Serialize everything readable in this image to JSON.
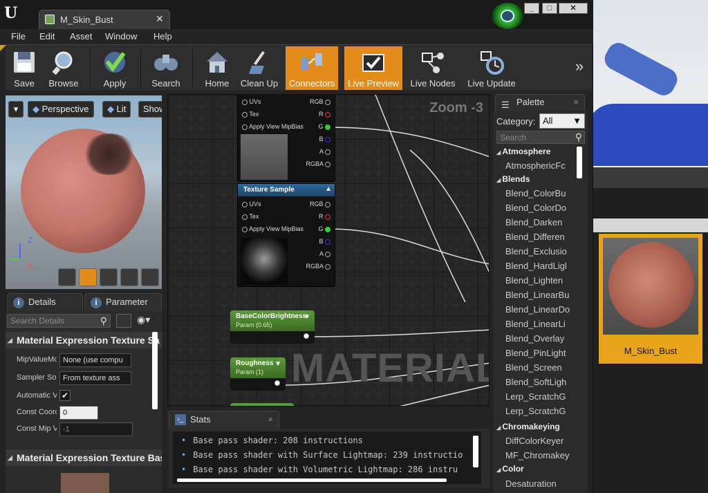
{
  "window": {
    "tab_title": "M_Skin_Bust"
  },
  "menu": [
    "File",
    "Edit",
    "Asset",
    "Window",
    "Help"
  ],
  "toolbar": {
    "save": "Save",
    "browse": "Browse",
    "apply": "Apply",
    "search": "Search",
    "home": "Home",
    "cleanup": "Clean Up",
    "connectors": "Connectors",
    "livepreview": "Live Preview",
    "livenodes": "Live Nodes",
    "liveupdate": "Live Update"
  },
  "viewport": {
    "perspective": "Perspective",
    "lit": "Lit",
    "show": "Show",
    "axis_z": "Z",
    "axis_x": "X"
  },
  "details": {
    "tab_details": "Details",
    "tab_params": "Parameter",
    "search_placeholder": "Search Details",
    "section1": "Material Expression Texture Sa",
    "section2": "Material Expression Texture Bas",
    "rows": [
      {
        "label": "MipValueMo",
        "value": "None (use compu"
      },
      {
        "label": "Sampler So",
        "value": "From texture ass"
      },
      {
        "label": "Automatic V",
        "value": "✔"
      },
      {
        "label": "Const Coord",
        "value": "0"
      },
      {
        "label": "Const Mip V",
        "value": "-1"
      }
    ]
  },
  "graph": {
    "zoom": "Zoom -3",
    "watermark": "MATERIAL",
    "node1": {
      "pins": [
        "UVs",
        "Tex",
        "Apply View MipBias"
      ],
      "outs": [
        "RGB",
        "R",
        "G",
        "B",
        "A",
        "RGBA"
      ]
    },
    "node2": {
      "title": "Texture Sample",
      "pins": [
        "UVs",
        "Tex",
        "Apply View MipBias"
      ],
      "outs": [
        "RGB",
        "R",
        "G",
        "B",
        "A",
        "RGBA"
      ]
    },
    "param1": {
      "title": "BaseColorBrightness",
      "sub": "Param (0.65)"
    },
    "param2": {
      "title": "Roughness",
      "sub": "Param (1)"
    }
  },
  "stats": {
    "tab": "Stats",
    "lines": [
      "Base pass shader: 208 instructions",
      "Base pass shader with Surface Lightmap: 239 instructio",
      "Base pass shader with Volumetric Lightmap: 286 instru"
    ]
  },
  "palette": {
    "tab": "Palette",
    "category_label": "Category:",
    "category_value": "All",
    "search_placeholder": "Search",
    "cat_atmosphere": "Atmosphere",
    "atmos_items": [
      "AtmosphericFc"
    ],
    "cat_blends": "Blends",
    "blend_items": [
      "Blend_ColorBu",
      "Blend_ColorDo",
      "Blend_Darken",
      "Blend_Differen",
      "Blend_Exclusio",
      "Blend_HardLigl",
      "Blend_Lighten",
      "Blend_LinearBu",
      "Blend_LinearDo",
      "Blend_LinearLi",
      "Blend_Overlay",
      "Blend_PinLight",
      "Blend_Screen",
      "Blend_SoftLigh",
      "Lerp_ScratchG",
      "Lerp_ScratchG"
    ],
    "cat_chroma": "Chromakeying",
    "chroma_items": [
      "DiffColorKeyer",
      "MF_Chromakey"
    ],
    "cat_color": "Color",
    "color_items": [
      "Desaturation"
    ]
  },
  "asset": {
    "name": "M_Skin_Bust"
  },
  "colors": {
    "accent": "#e38c1b",
    "param_green": "#5d9a3a",
    "node_blue": "#2f6a9e"
  }
}
